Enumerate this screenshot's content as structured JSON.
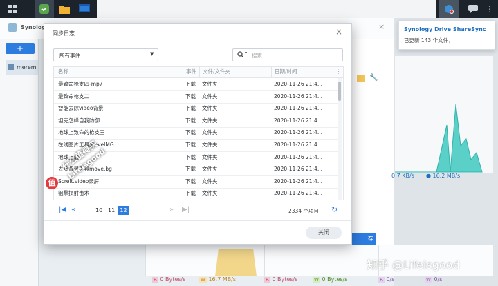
{
  "taskbar": {
    "icons": [
      "grid-icon",
      "sharesync-icon",
      "folder-icon",
      "monitor-icon"
    ]
  },
  "bg_app": {
    "title": "Synolog",
    "sidebar_item": "merem",
    "add_label": "+",
    "speed_down": "0.7 KB/s",
    "speed_up": "16.2 MB/s",
    "close_btn_partial": "存"
  },
  "bottom_stats": [
    {
      "badge": "R",
      "label": "0 Bytes/s",
      "color": "#e0708f"
    },
    {
      "badge": "W",
      "label": "16.7 MB/s",
      "color": "#e8b04a"
    },
    {
      "badge": "R",
      "label": "0 Bytes/s",
      "color": "#e0708f"
    },
    {
      "badge": "W",
      "label": "0 Bytes/s",
      "color": "#7bc043"
    },
    {
      "badge": "R",
      "label": "0/s",
      "color": "#b07dc7"
    },
    {
      "badge": "W",
      "label": "0/s",
      "color": "#b07dc7"
    }
  ],
  "notification": {
    "title": "Synology Drive ShareSync",
    "body": "已更新 143 个文件，"
  },
  "dialog": {
    "title": "同步日志",
    "filter_value": "所有事件",
    "search_placeholder": "搜索",
    "columns": {
      "name": "名称",
      "event": "事件",
      "type": "文件/文件夹",
      "time": "日期/时间"
    },
    "rows": [
      {
        "name": "最致命枪支四-mp7",
        "event": "下载",
        "type": "文件夹",
        "time": "2020-11-26 21:4..."
      },
      {
        "name": "最致命枪支二",
        "event": "下载",
        "type": "文件夹",
        "time": "2020-11-26 21:4..."
      },
      {
        "name": "智能去除video背景",
        "event": "下载",
        "type": "文件夹",
        "time": "2020-11-26 21:4..."
      },
      {
        "name": "坦克怎样自我防御",
        "event": "下载",
        "type": "文件夹",
        "time": "2020-11-26 21:4..."
      },
      {
        "name": "地球上致命的枪支三",
        "event": "下载",
        "type": "文件夹",
        "time": "2020-11-26 21:4..."
      },
      {
        "name": "在线图片工具集oveIMG",
        "event": "下载",
        "type": "文件夹",
        "time": "2020-11-26 21:4..."
      },
      {
        "name": "地球上最",
        "event": "下载",
        "type": "文件夹",
        "time": "2020-11-26 21:4..."
      },
      {
        "name": "去除背景工具move.bg",
        "event": "下载",
        "type": "文件夹",
        "time": "2020-11-26 21:4..."
      },
      {
        "name": "Screlt.video录屏",
        "event": "下载",
        "type": "文件夹",
        "time": "2020-11-26 21:4..."
      },
      {
        "name": "狙擊损射击术",
        "event": "下载",
        "type": "文件夹",
        "time": "2020-11-26 21:4..."
      }
    ],
    "pagination": {
      "pages": [
        "10",
        "11",
        "12"
      ],
      "current": "12",
      "total": "2334 个项目"
    },
    "close_label": "关闭"
  },
  "watermark": {
    "line1": "什么值得买",
    "line2": "Lifeisgood",
    "logo": "值",
    "corner": "知乎 @Lifeisgood"
  }
}
